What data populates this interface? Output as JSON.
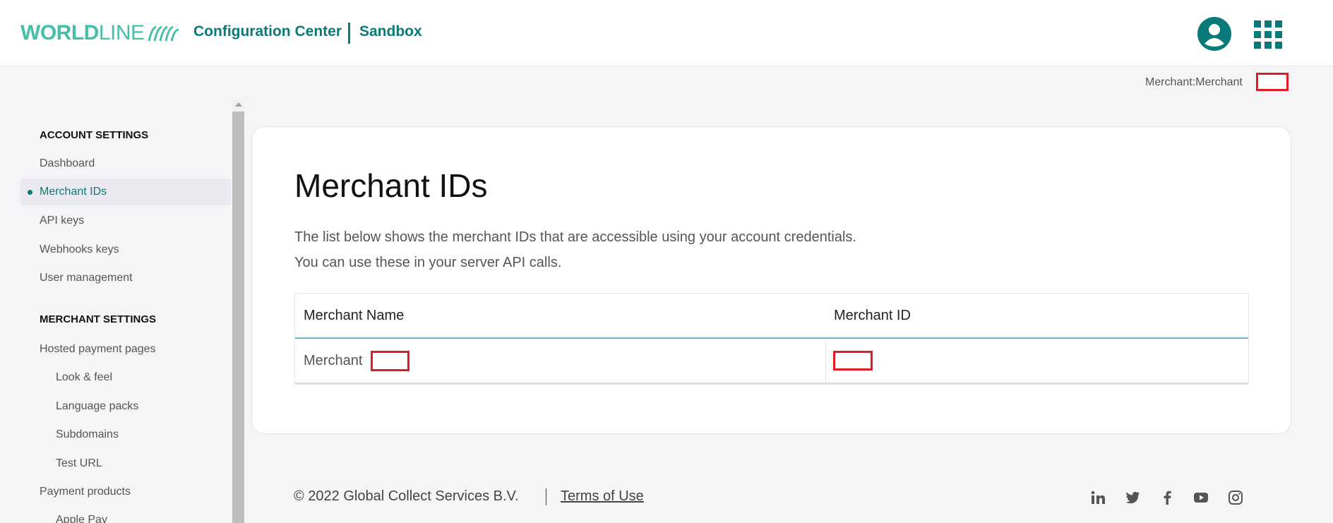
{
  "header": {
    "logo_bold": "WORLD",
    "logo_thin": "LINE",
    "app_title": "Configuration Center",
    "environment": "Sandbox",
    "user_icon": "user-circle-icon",
    "apps_icon": "apps-grid-icon"
  },
  "merchant_line": "Merchant:Merchant",
  "sidebar": {
    "account_settings_label": "ACCOUNT SETTINGS",
    "account_items": [
      {
        "label": "Dashboard"
      },
      {
        "label": "Merchant IDs",
        "active": true
      },
      {
        "label": "API keys"
      },
      {
        "label": "Webhooks keys"
      },
      {
        "label": "User management"
      }
    ],
    "merchant_settings_label": "MERCHANT SETTINGS",
    "merchant_items": [
      {
        "label": "Hosted payment pages"
      },
      {
        "label": "Look & feel"
      },
      {
        "label": "Language packs"
      },
      {
        "label": "Subdomains"
      },
      {
        "label": "Test URL"
      },
      {
        "label": "Payment products"
      },
      {
        "label": "Apple Pay"
      }
    ]
  },
  "main": {
    "title": "Merchant IDs",
    "description_line1": "The list below shows the merchant IDs that are accessible using your account credentials.",
    "description_line2": "You can use these in your server API calls.",
    "table": {
      "headers": [
        "Merchant Name",
        "Merchant ID"
      ],
      "rows": [
        {
          "name": "Merchant",
          "id": ""
        }
      ]
    }
  },
  "footer": {
    "copyright": "© 2022 Global Collect Services B.V.",
    "terms": "Terms of Use",
    "social": [
      "linkedin-icon",
      "twitter-icon",
      "facebook-icon",
      "youtube-icon",
      "instagram-icon"
    ]
  },
  "colors": {
    "brand": "#46beaa",
    "accent": "#0a7a78",
    "redaction": "#e01b24"
  }
}
